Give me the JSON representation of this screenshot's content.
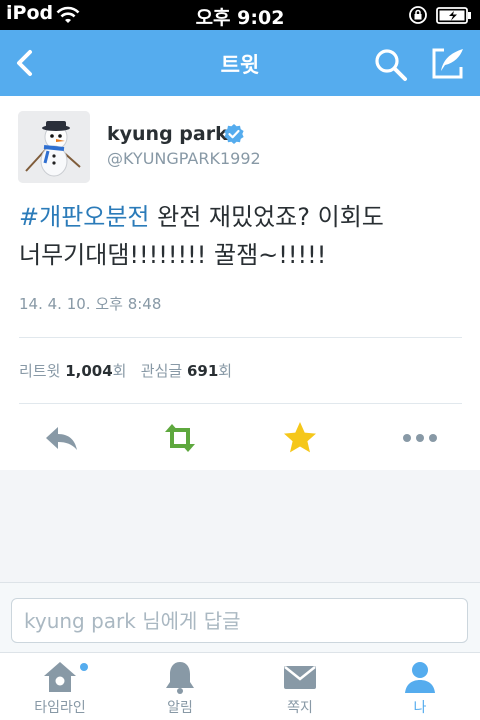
{
  "status_bar": {
    "carrier": "iPod",
    "time": "오후 9:02"
  },
  "nav": {
    "title": "트윗"
  },
  "tweet": {
    "author_name": "kyung park",
    "author_handle": "@KYUNGPARK1992",
    "hashtag": "#개판오분전",
    "text_line1_rest": " 완전 재밌었죠? 이회도",
    "text_line2": "너무기대댐!!!!!!!! 꿀잼~!!!!!",
    "timestamp": "14. 4. 10. 오후 8:48",
    "stats": {
      "retweet_label": "리트윗",
      "retweet_count": "1,004",
      "retweet_unit": "회",
      "favorite_label": "관심글",
      "favorite_count": "691",
      "favorite_unit": "회"
    },
    "actions": [
      "reply-icon",
      "retweet-icon",
      "favorite-star-icon",
      "more-icon"
    ]
  },
  "reply": {
    "placeholder": "kyung park 님에게 답글"
  },
  "tabs": [
    {
      "label": "타임라인",
      "icon": "home-icon"
    },
    {
      "label": "알림",
      "icon": "bell-icon"
    },
    {
      "label": "쪽지",
      "icon": "envelope-icon"
    },
    {
      "label": "나",
      "icon": "person-icon",
      "active": true
    }
  ],
  "colors": {
    "brand_blue": "#55acee",
    "retweet_green": "#5ea83e",
    "favorite_yellow": "#f5c71a",
    "hashtag_blue": "#2b7bb9"
  }
}
